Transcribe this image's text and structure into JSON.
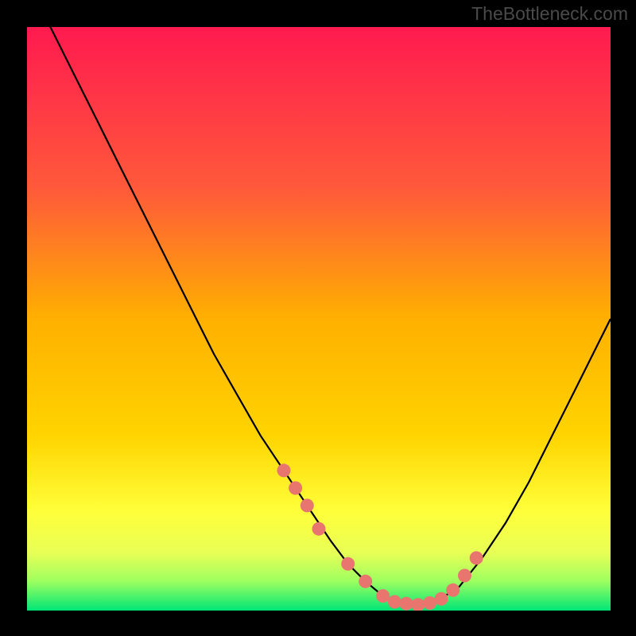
{
  "watermark": "TheBottleneck.com",
  "colors": {
    "bg": "#000000",
    "gradient_top": "#ff1a4f",
    "gradient_mid1": "#ff7a2a",
    "gradient_mid2": "#ffd400",
    "gradient_mid3": "#ffff33",
    "gradient_mid4": "#c8ff4a",
    "gradient_bot": "#00e676",
    "curve": "#000000",
    "dot": "#e8766f"
  },
  "chart_data": {
    "type": "line",
    "title": "",
    "xlabel": "",
    "ylabel": "",
    "xlim": [
      0,
      100
    ],
    "ylim": [
      0,
      100
    ],
    "grid": false,
    "legend": false,
    "series": [
      {
        "name": "bottleneck-curve",
        "x": [
          0,
          4,
          8,
          12,
          16,
          20,
          24,
          28,
          32,
          36,
          40,
          44,
          48,
          52,
          55,
          58,
          61,
          64,
          67,
          70,
          74,
          78,
          82,
          86,
          90,
          94,
          98,
          100
        ],
        "y": [
          108,
          100,
          92,
          84,
          76,
          68,
          60,
          52,
          44,
          37,
          30,
          24,
          18,
          12,
          8,
          5,
          2.5,
          1.2,
          1.0,
          1.5,
          4,
          9,
          15,
          22,
          30,
          38,
          46,
          50
        ]
      }
    ],
    "markers": {
      "name": "highlight-dots",
      "x": [
        44,
        46,
        48,
        50,
        55,
        58,
        61,
        63,
        65,
        67,
        69,
        71,
        73,
        75,
        77
      ],
      "y": [
        24,
        21,
        18,
        14,
        8,
        5,
        2.5,
        1.5,
        1.2,
        1.0,
        1.3,
        2,
        3.5,
        6,
        9
      ]
    }
  }
}
